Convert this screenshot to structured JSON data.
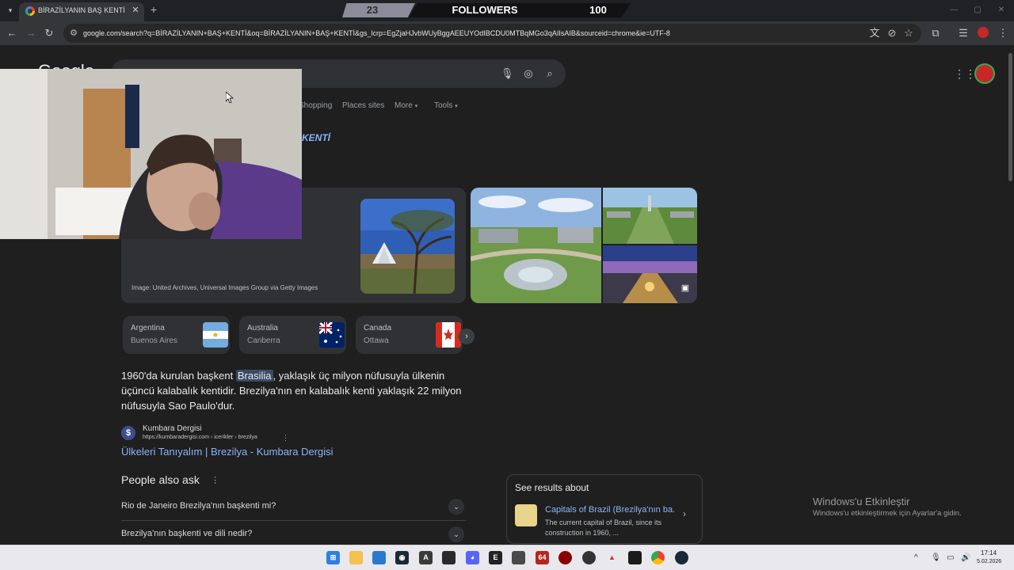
{
  "browser": {
    "tab_title": "BİRAZİLYANIN BAŞ KENTİ - Goo",
    "tab_list_icon": "chevron-down-icon",
    "new_tab_icon": "plus-icon",
    "url": "google.com/search?q=BİRAZİLYANIN+BAŞ+KENTİ&oq=BİRAZİLYANIN+BAŞ+KENTİ&gs_lcrp=EgZjaHJvbWUyBggAEEUYOdIBCDU0MTBqMGo3qAIIsAIB&sourceid=chrome&ie=UTF-8"
  },
  "followers_overlay": {
    "current": "23",
    "label": "FOLLOWERS",
    "goal": "100",
    "progress_fraction": 0.23
  },
  "google": {
    "logo_text": "Google",
    "nav_tabs": [
      "Shopping",
      "Places sites",
      "More",
      "Tools"
    ],
    "query_title_fragment": "KENTİ"
  },
  "knowledge_panel": {
    "image_credit": "Image: United Archives, Universal Images Group via Getty Images"
  },
  "countries": [
    {
      "country": "Argentina",
      "capital": "Buenos Aires"
    },
    {
      "country": "Australia",
      "capital": "Canberra"
    },
    {
      "country": "Canada",
      "capital": "Ottawa"
    }
  ],
  "snippet": {
    "before": "1960'da kurulan başkent ",
    "highlight": "Brasilia",
    "after": ", yaklaşık üç milyon nüfusuyla ülkenin üçüncü kalabalık kentidir. Brezilya'nın en kalabalık kenti yaklaşık 22 milyon nüfusuyla Sao Paulo'dur."
  },
  "source": {
    "name": "Kumbara Dergisi",
    "url": "https://kumbaradergisi.com › icerikler › brezilya",
    "link_title": "Ülkeleri Tanıyalım | Brezilya - Kumbara Dergisi"
  },
  "people_also_ask": {
    "title": "People also ask",
    "questions": [
      "Rio de Janeiro Brezilya'nın başkenti mi?",
      "Brezilya'nın başkenti ve dili nedir?"
    ]
  },
  "see_results_about": {
    "title": "See results about",
    "link": "Capitals of Brazil (Brezilya'nın ba...",
    "desc": "The current capital of Brazil, since its construction in 1960, ..."
  },
  "windows_activation": {
    "title": "Windows'u Etkinleştir",
    "subtitle": "Windows'u etkinleştirmek için Ayarlar'a gidin."
  },
  "taskbar": {
    "time": "17:14",
    "date": "5.02.2026",
    "badge_64": "64"
  },
  "colors": {
    "link": "#8ab4f8",
    "page_bg": "#1f1f1f",
    "card_bg": "#303134"
  }
}
